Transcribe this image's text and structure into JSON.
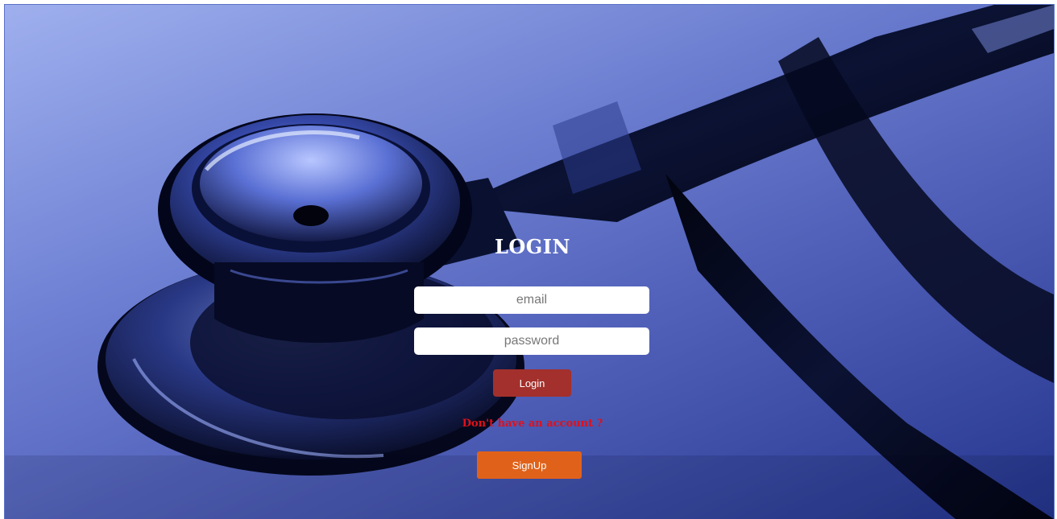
{
  "login": {
    "title": "LOGIN",
    "email_placeholder": "email",
    "password_placeholder": "password",
    "login_button_label": "Login",
    "no_account_text": "Don't have an account ?",
    "signup_button_label": "SignUp"
  },
  "background": {
    "subject": "stethoscope",
    "tint_color": "#4c60cf"
  },
  "colors": {
    "login_button": "#a3302c",
    "signup_button": "#e0621a",
    "no_account_text": "#e0101a"
  }
}
